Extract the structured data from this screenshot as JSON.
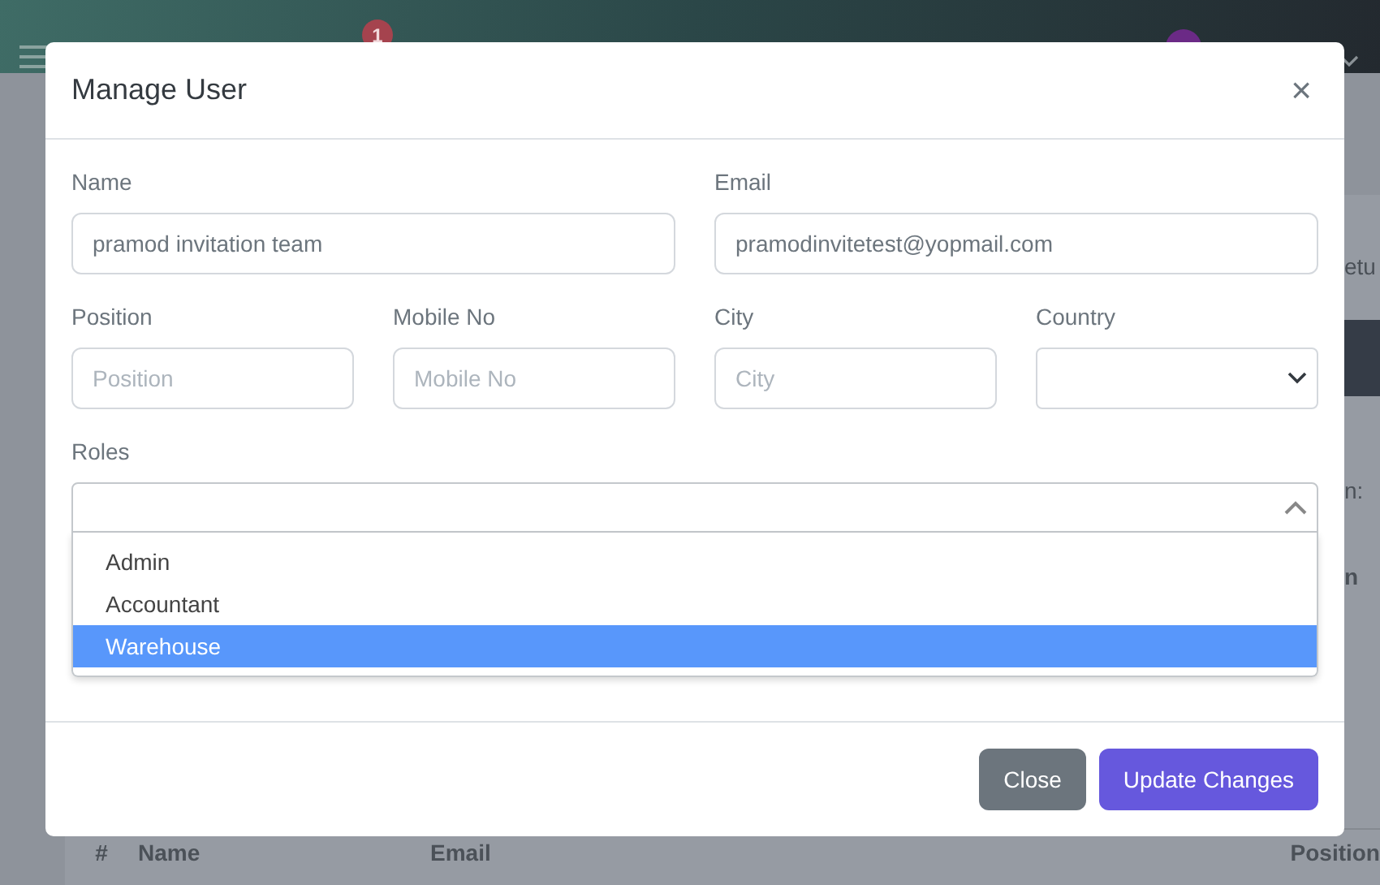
{
  "background": {
    "notification_badge": "1",
    "side_fragments": [
      "etu",
      "n:",
      "n"
    ],
    "table_columns": [
      "#",
      "Name",
      "Email",
      "Position"
    ]
  },
  "modal": {
    "title": "Manage User",
    "close_label": "×",
    "fields": [
      {
        "label": "Name",
        "kind": "text",
        "value": "pramod invitation team"
      },
      {
        "label": "Email",
        "kind": "text",
        "value": "pramodinvitetest@yopmail.com"
      },
      {
        "label": "Position",
        "kind": "text",
        "placeholder": "Position"
      },
      {
        "label": "Mobile No",
        "kind": "text",
        "placeholder": "Mobile No"
      },
      {
        "label": "City",
        "kind": "text",
        "placeholder": "City"
      },
      {
        "label": "Country",
        "kind": "select"
      }
    ],
    "roles": {
      "label": "Roles",
      "expanded": true,
      "options": [
        {
          "label": "Admin",
          "selected": false
        },
        {
          "label": "Accountant",
          "selected": false
        },
        {
          "label": "Warehouse",
          "selected": true
        }
      ]
    },
    "buttons": [
      {
        "label": "Close",
        "kind": "secondary"
      },
      {
        "label": "Update Changes",
        "kind": "primary"
      }
    ]
  }
}
